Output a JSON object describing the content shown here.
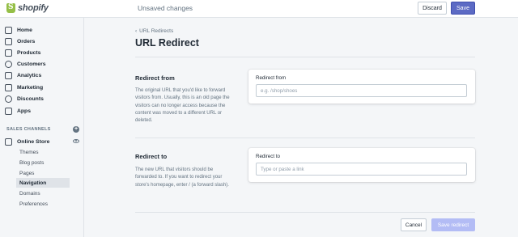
{
  "topbar": {
    "logo_text": "shopify",
    "status_text": "Unsaved changes",
    "discard_label": "Discard",
    "save_label": "Save"
  },
  "sidebar": {
    "items": [
      {
        "label": "Home",
        "icon": "home-icon"
      },
      {
        "label": "Orders",
        "icon": "orders-icon"
      },
      {
        "label": "Products",
        "icon": "products-icon"
      },
      {
        "label": "Customers",
        "icon": "customers-icon"
      },
      {
        "label": "Analytics",
        "icon": "analytics-icon"
      },
      {
        "label": "Marketing",
        "icon": "marketing-icon"
      },
      {
        "label": "Discounts",
        "icon": "discounts-icon"
      },
      {
        "label": "Apps",
        "icon": "apps-icon"
      }
    ],
    "sales_channels_label": "SALES CHANNELS",
    "online_store": {
      "label": "Online Store",
      "sub_items": [
        {
          "label": "Themes",
          "active": false
        },
        {
          "label": "Blog posts",
          "active": false
        },
        {
          "label": "Pages",
          "active": false
        },
        {
          "label": "Navigation",
          "active": true
        },
        {
          "label": "Domains",
          "active": false
        },
        {
          "label": "Preferences",
          "active": false
        }
      ]
    }
  },
  "main": {
    "breadcrumb": "URL Redirects",
    "title": "URL Redirect",
    "redirect_from": {
      "heading": "Redirect from",
      "description": "The original URL that you'd like to forward visitors from. Usually, this is an old page the visitors can no longer access because the content was moved to a different URL or deleted.",
      "field_label": "Redirect from",
      "value": "",
      "placeholder": "e.g. /shop/shoes"
    },
    "redirect_to": {
      "heading": "Redirect to",
      "description": "The new URL that visitors should be forwarded to. If you want to redirect your store's homepage, enter / (a forward slash).",
      "field_label": "Redirect to",
      "value": "",
      "placeholder": "Type or paste a link"
    },
    "cancel_label": "Cancel",
    "save_redirect_label": "Save redirect"
  },
  "colors": {
    "primary": "#5c6ac4",
    "primary_disabled": "#b3bcf5",
    "logo_green": "#95bf47"
  }
}
